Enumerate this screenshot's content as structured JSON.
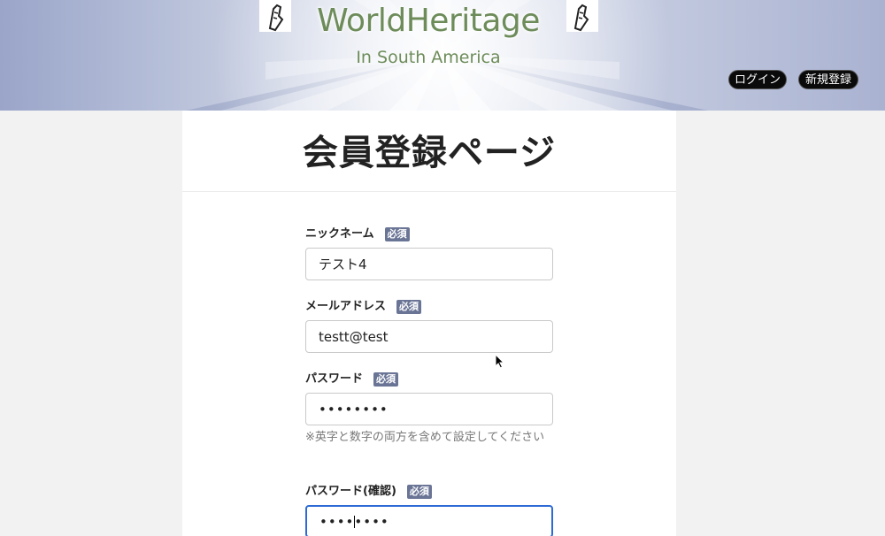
{
  "header": {
    "logo_title": "WorldHeritage",
    "logo_subtitle": "In South America",
    "login_label": "ログイン",
    "signup_label": "新規登録"
  },
  "form": {
    "page_title": "会員登録ページ",
    "required_badge": "必須",
    "fields": [
      {
        "label": "ニックネーム",
        "value": "テスト4"
      },
      {
        "label": "メールアドレス",
        "value": "testt@test"
      },
      {
        "label": "パスワード",
        "value": "••••••••"
      },
      {
        "label": "パスワード(確認)",
        "value": "••••••••"
      }
    ],
    "password_hint": "※英字と数字の両方を含めて設定してください"
  },
  "colors": {
    "logo_green": "#6d8c5a",
    "badge_bg": "#6a7596",
    "focus_border": "#2d6ad6"
  }
}
